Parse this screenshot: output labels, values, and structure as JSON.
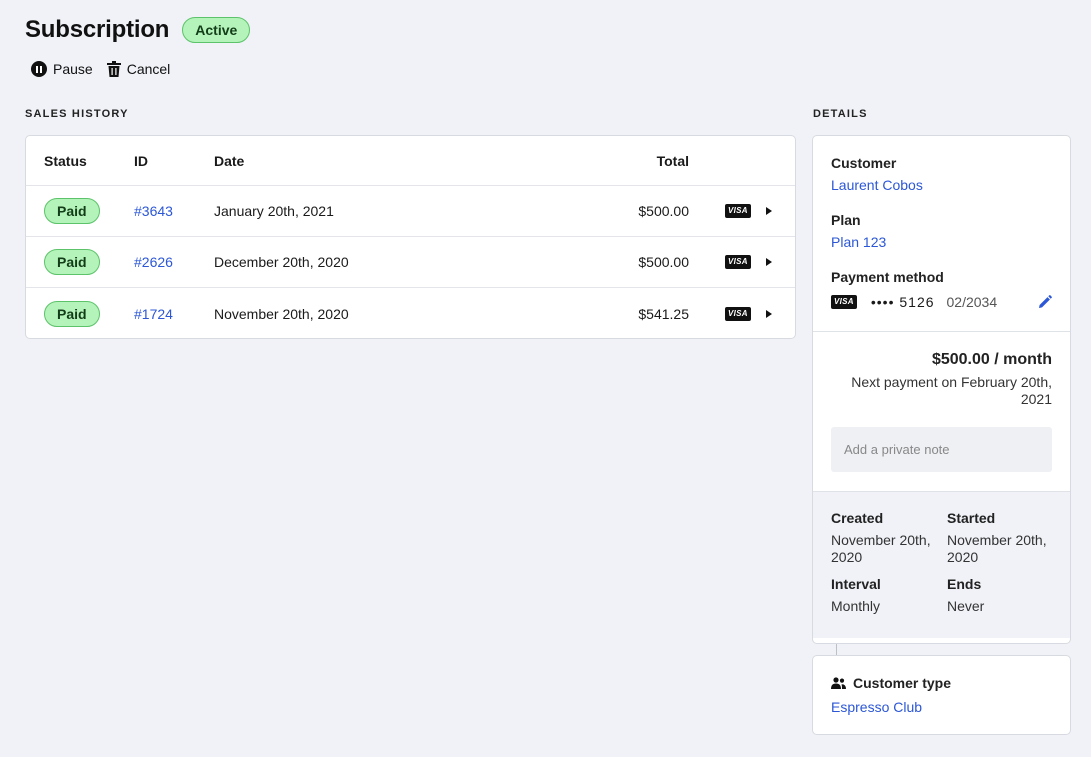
{
  "header": {
    "title": "Subscription",
    "status": "Active",
    "pause_label": "Pause",
    "cancel_label": "Cancel"
  },
  "sales_history": {
    "label": "SALES HISTORY",
    "columns": {
      "status": "Status",
      "id": "ID",
      "date": "Date",
      "total": "Total"
    },
    "rows": [
      {
        "status": "Paid",
        "id": "#3643",
        "date": "January 20th, 2021",
        "total": "$500.00",
        "card": "VISA"
      },
      {
        "status": "Paid",
        "id": "#2626",
        "date": "December 20th, 2020",
        "total": "$500.00",
        "card": "VISA"
      },
      {
        "status": "Paid",
        "id": "#1724",
        "date": "November 20th, 2020",
        "total": "$541.25",
        "card": "VISA"
      }
    ]
  },
  "details": {
    "label": "DETAILS",
    "customer_label": "Customer",
    "customer_name": "Laurent Cobos",
    "plan_label": "Plan",
    "plan_name": "Plan 123",
    "payment_label": "Payment method",
    "card_brand": "VISA",
    "card_last4": "•••• 5126",
    "card_expiry": "02/2034",
    "amount": "$500.00 / month",
    "next_payment": "Next payment on February 20th, 2021",
    "note_placeholder": "Add a private note",
    "created_label": "Created",
    "created_value": "November 20th, 2020",
    "started_label": "Started",
    "started_value": "November 20th, 2020",
    "interval_label": "Interval",
    "interval_value": "Monthly",
    "ends_label": "Ends",
    "ends_value": "Never"
  },
  "customer_type": {
    "label": "Customer type",
    "value": "Espresso Club"
  },
  "colors": {
    "background": "#f0f2f7",
    "link": "#2c57d6",
    "badge_bg": "#b4f3b9",
    "badge_border": "#5cc36a"
  }
}
